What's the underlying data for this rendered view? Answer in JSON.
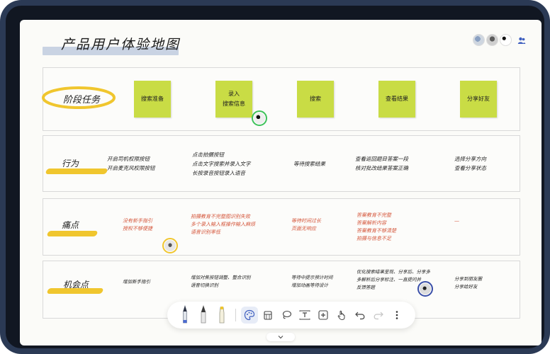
{
  "board": {
    "title": "产品用户体验地图"
  },
  "rows": {
    "stage": {
      "label": "阶段任务"
    },
    "action": {
      "label": "行为"
    },
    "pain": {
      "label": "痛点"
    },
    "opportunity": {
      "label": "机会点"
    }
  },
  "stickies": [
    {
      "text": "搜索准备"
    },
    {
      "text": "录入\n搜索信息"
    },
    {
      "text": "搜索"
    },
    {
      "text": "查看结果"
    },
    {
      "text": "分享好友"
    }
  ],
  "actions": [
    "开启司机权限按钮\n开启麦克风权限按钮",
    "点击拍摄按钮\n点击文字搜索并录入文字\n长按录音按钮录入语音",
    "等待搜索结果",
    "查看返回题目答案一段\n核对批改结果答案正确",
    "选择分享方向\n查看分享状态"
  ],
  "pains": [
    "没有新手指引\n授权不够便捷",
    "拍摄教育不完整图识别失败\n多个录入输入框操作输入麻烦\n语音识别率低",
    "等待时间过长\n页面无响应",
    "答案教育不完整\n答案解析内容\n答案教育不够清楚\n拍摄与信息不足",
    "—"
  ],
  "opportunities": [
    "增加新手指引",
    "增加对焦按钮调整、整合识别\n语音切换识别",
    "等待中提示预计时间\n增加动画等待设计",
    "优化搜索结果呈现、分享后、分享多\n多解析后分享标注、一直提问并\n反馈答题",
    "分享到朋友圈\n分享给好友"
  ],
  "toolbar": {
    "tools": [
      {
        "icon": "fountain-pen-icon"
      },
      {
        "icon": "pencil-icon"
      },
      {
        "icon": "highlighter-icon"
      },
      {
        "icon": "palette-icon"
      },
      {
        "icon": "eraser-icon"
      },
      {
        "icon": "lasso-icon"
      },
      {
        "icon": "text-box-icon"
      },
      {
        "icon": "add-icon"
      },
      {
        "icon": "hand-icon"
      },
      {
        "icon": "undo-icon"
      },
      {
        "icon": "redo-icon"
      },
      {
        "icon": "more-icon"
      }
    ]
  },
  "colors": {
    "sticky": "#c9dc45",
    "highlight": "#f0c62e",
    "title_band": "#c9d3e3",
    "pain_text": "#d4553a",
    "frame": "#2b3a55"
  }
}
